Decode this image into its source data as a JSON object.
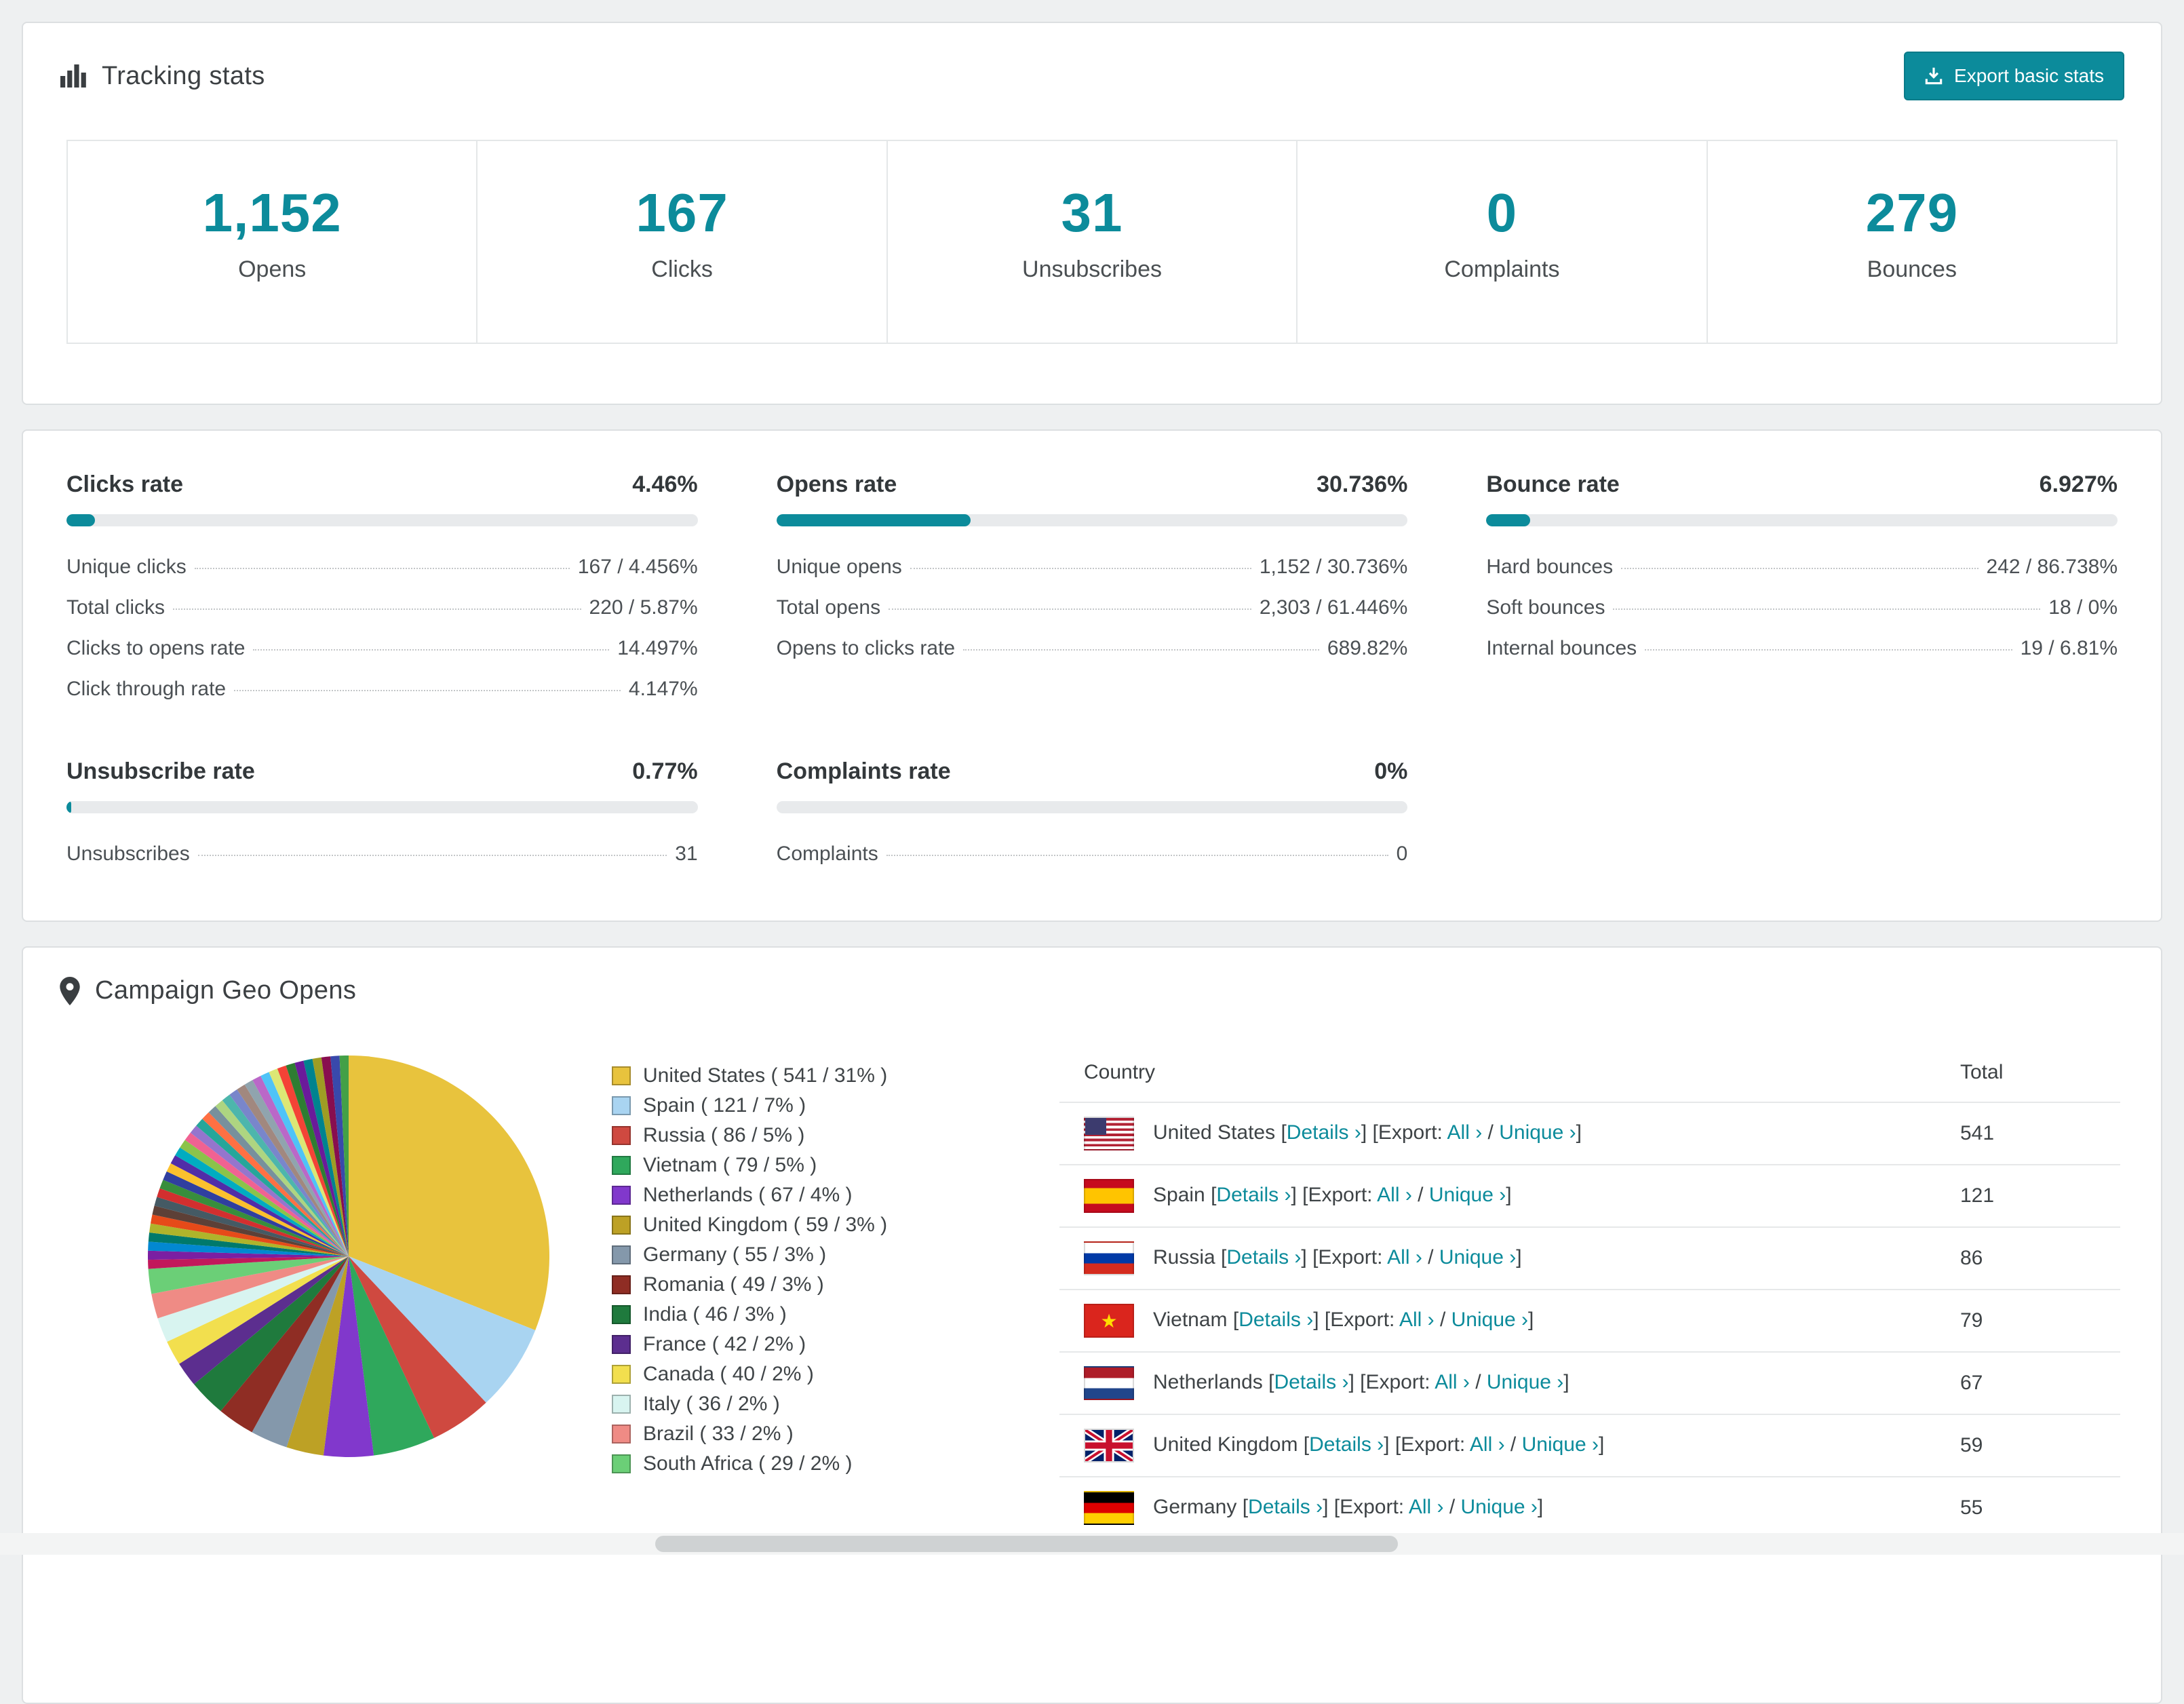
{
  "theme": {
    "accent": "#0c8b9b",
    "page_bg": "#eef0f1",
    "card_border": "#dcdfe1",
    "bar_bg": "#e8eaec"
  },
  "tracking": {
    "title": "Tracking stats",
    "export_button": "Export basic stats",
    "stats": [
      {
        "value": "1,152",
        "label": "Opens"
      },
      {
        "value": "167",
        "label": "Clicks"
      },
      {
        "value": "31",
        "label": "Unsubscribes"
      },
      {
        "value": "0",
        "label": "Complaints"
      },
      {
        "value": "279",
        "label": "Bounces"
      }
    ]
  },
  "rates": [
    {
      "title": "Clicks rate",
      "value": "4.46%",
      "pct": 4.46,
      "rows": [
        {
          "label": "Unique clicks",
          "value": "167 / 4.456%"
        },
        {
          "label": "Total clicks",
          "value": "220 / 5.87%"
        },
        {
          "label": "Clicks to opens rate",
          "value": "14.497%"
        },
        {
          "label": "Click through rate",
          "value": "4.147%"
        }
      ]
    },
    {
      "title": "Opens rate",
      "value": "30.736%",
      "pct": 30.736,
      "rows": [
        {
          "label": "Unique opens",
          "value": "1,152 / 30.736%"
        },
        {
          "label": "Total opens",
          "value": "2,303 / 61.446%"
        },
        {
          "label": "Opens to clicks rate",
          "value": "689.82%"
        }
      ]
    },
    {
      "title": "Bounce rate",
      "value": "6.927%",
      "pct": 6.927,
      "rows": [
        {
          "label": "Hard bounces",
          "value": "242 / 86.738%"
        },
        {
          "label": "Soft bounces",
          "value": "18 / 0%"
        },
        {
          "label": "Internal bounces",
          "value": "19 / 6.81%"
        }
      ]
    },
    {
      "title": "Unsubscribe rate",
      "value": "0.77%",
      "pct": 0.77,
      "rows": [
        {
          "label": "Unsubscribes",
          "value": "31"
        }
      ]
    },
    {
      "title": "Complaints rate",
      "value": "0%",
      "pct": 0,
      "rows": [
        {
          "label": "Complaints",
          "value": "0"
        }
      ]
    }
  ],
  "geo": {
    "title": "Campaign Geo Opens",
    "table": {
      "country_header": "Country",
      "total_header": "Total",
      "details_label": "Details",
      "export_label": "Export:",
      "all_label": "All",
      "unique_label": "Unique",
      "arrow": "›",
      "bracket_open": "[",
      "bracket_close": "]",
      "separator": "/",
      "rows": [
        {
          "flag": "us",
          "country": "United States",
          "total": "541"
        },
        {
          "flag": "es",
          "country": "Spain",
          "total": "121"
        },
        {
          "flag": "ru",
          "country": "Russia",
          "total": "86"
        },
        {
          "flag": "vn",
          "country": "Vietnam",
          "total": "79"
        },
        {
          "flag": "nl",
          "country": "Netherlands",
          "total": "67"
        },
        {
          "flag": "gb",
          "country": "United Kingdom",
          "total": "59"
        },
        {
          "flag": "de",
          "country": "Germany",
          "total": "55"
        }
      ]
    }
  },
  "chart_data": {
    "type": "pie",
    "title": "Campaign Geo Opens",
    "unit": "opens",
    "legend_position": "right",
    "slices": [
      {
        "label": "United States",
        "value": 541,
        "pct": 31,
        "color": "#e8c33d"
      },
      {
        "label": "Spain",
        "value": 121,
        "pct": 7,
        "color": "#a9d4f1"
      },
      {
        "label": "Russia",
        "value": 86,
        "pct": 5,
        "color": "#cf4940"
      },
      {
        "label": "Vietnam",
        "value": 79,
        "pct": 5,
        "color": "#2fa85c"
      },
      {
        "label": "Netherlands",
        "value": 67,
        "pct": 4,
        "color": "#8138cc"
      },
      {
        "label": "United Kingdom",
        "value": 59,
        "pct": 3,
        "color": "#bda125"
      },
      {
        "label": "Germany",
        "value": 55,
        "pct": 3,
        "color": "#8498ab"
      },
      {
        "label": "Romania",
        "value": 49,
        "pct": 3,
        "color": "#8f2d24"
      },
      {
        "label": "India",
        "value": 46,
        "pct": 3,
        "color": "#1f7a3d"
      },
      {
        "label": "France",
        "value": 42,
        "pct": 2,
        "color": "#5c2e8f"
      },
      {
        "label": "Canada",
        "value": 40,
        "pct": 2,
        "color": "#f2df4e"
      },
      {
        "label": "Italy",
        "value": 36,
        "pct": 2,
        "color": "#d8f4f0"
      },
      {
        "label": "Brazil",
        "value": 33,
        "pct": 2,
        "color": "#ef8b85"
      },
      {
        "label": "South Africa",
        "value": 29,
        "pct": 2,
        "color": "#6bcf77"
      }
    ],
    "other_slices": {
      "total_pct": 26,
      "count": 36,
      "palette": [
        "#c2185b",
        "#7b1fa2",
        "#0288d1",
        "#00796b",
        "#afb42b",
        "#e64a19",
        "#5d4037",
        "#455a64",
        "#d32f2f",
        "#388e3c",
        "#303f9f",
        "#fbc02d",
        "#512da8",
        "#00acc1",
        "#8bc34a",
        "#f06292",
        "#9575cd",
        "#26a69a",
        "#ff7043",
        "#78909c",
        "#aed581",
        "#4db6ac",
        "#7986cb",
        "#a1887f",
        "#90a4ae",
        "#ba68c8",
        "#4fc3f7",
        "#dce775",
        "#f44336",
        "#2e7d32",
        "#6a1b9a",
        "#00838f",
        "#9e9d24",
        "#880e4f",
        "#3949ab",
        "#43a047"
      ]
    }
  }
}
